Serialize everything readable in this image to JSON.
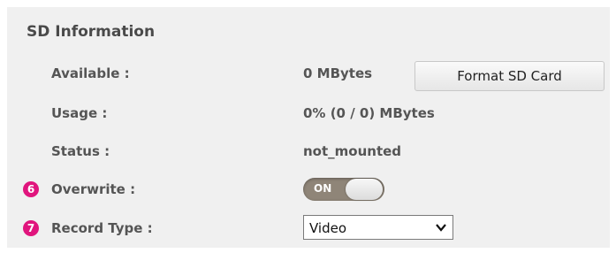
{
  "section": {
    "title": "SD Information"
  },
  "rows": {
    "available": {
      "label": "Available :",
      "value": "0 MBytes"
    },
    "usage": {
      "label": "Usage :",
      "value": "0% (0 / 0) MBytes"
    },
    "status": {
      "label": "Status :",
      "value": "not_mounted"
    },
    "overwrite": {
      "badge": "6",
      "label": "Overwrite :",
      "toggle_text": "ON",
      "toggle_state": "on"
    },
    "record_type": {
      "badge": "7",
      "label": "Record Type :",
      "selected": "Video"
    }
  },
  "buttons": {
    "format": "Format SD Card"
  },
  "colors": {
    "panel_bg": "#f0f0f0",
    "badge": "#e0157d",
    "toggle_track": "#8f8578",
    "text": "#555555"
  },
  "icons": {
    "select_arrow": "chevron-down-icon"
  }
}
